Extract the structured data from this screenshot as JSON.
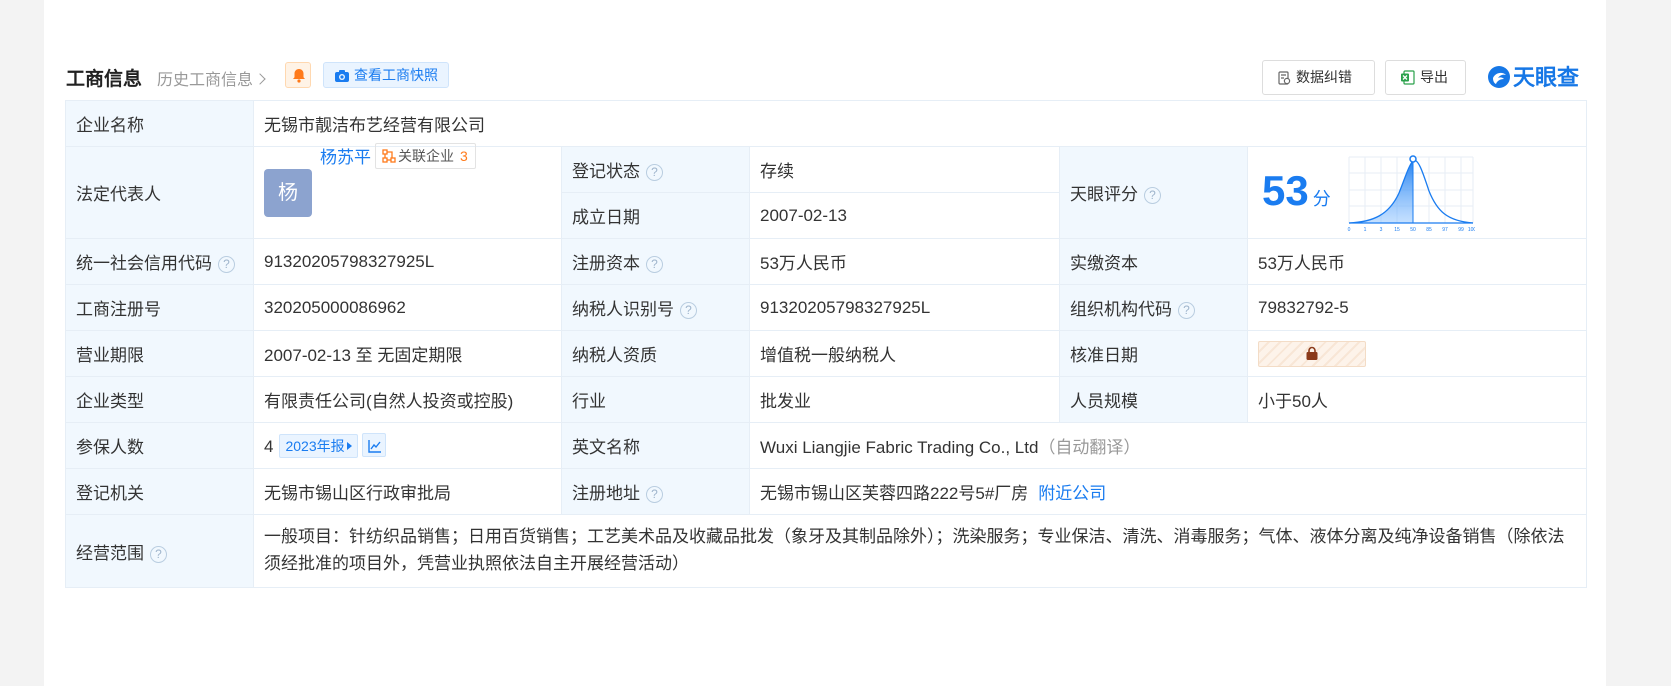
{
  "header": {
    "title": "工商信息",
    "history_link": "历史工商信息",
    "snapshot_button": "查看工商快照",
    "correct_button": "数据纠错",
    "export_button": "导出",
    "brand": "天眼查"
  },
  "labels": {
    "company_name": "企业名称",
    "legal_rep": "法定代表人",
    "reg_status": "登记状态",
    "establish_date": "成立日期",
    "tianyan_score": "天眼评分",
    "credit_code": "统一社会信用代码",
    "reg_capital": "注册资本",
    "paid_capital": "实缴资本",
    "reg_number": "工商注册号",
    "taxpayer_id": "纳税人识别号",
    "org_code": "组织机构代码",
    "business_term": "营业期限",
    "taxpayer_qual": "纳税人资质",
    "approval_date": "核准日期",
    "company_type": "企业类型",
    "industry": "行业",
    "staff_size": "人员规模",
    "insured_count": "参保人数",
    "english_name": "英文名称",
    "reg_authority": "登记机关",
    "reg_address": "注册地址",
    "business_scope": "经营范围"
  },
  "values": {
    "company_name": "无锡市靓洁布艺经营有限公司",
    "legal_rep_avatar": "杨",
    "legal_rep_name": "杨苏平",
    "related_label": "关联企业",
    "related_count": "3",
    "reg_status": "存续",
    "establish_date": "2007-02-13",
    "score": "53",
    "score_unit": "分",
    "credit_code": "91320205798327925L",
    "reg_capital": "53万人民币",
    "paid_capital": "53万人民币",
    "reg_number": "320205000086962",
    "taxpayer_id": "91320205798327925L",
    "org_code": "79832792-5",
    "business_term": "2007-02-13 至 无固定期限",
    "taxpayer_qual": "增值税一般纳税人",
    "company_type": "有限责任公司(自然人投资或控股)",
    "industry": "批发业",
    "staff_size": "小于50人",
    "insured_count": "4",
    "annual_report": "2023年报",
    "english_name": "Wuxi Liangjie Fabric Trading Co., Ltd",
    "auto_translate": "（自动翻译）",
    "reg_authority": "无锡市锡山区行政审批局",
    "reg_address": "无锡市锡山区芙蓉四路222号5#厂房",
    "nearby_link": "附近公司",
    "business_scope": "一般项目：针纺织品销售；日用百货销售；工艺美术品及收藏品批发（象牙及其制品除外）；洗染服务；专业保洁、清洗、消毒服务；气体、液体分离及纯净设备销售（除依法须经批准的项目外，凭营业执照依法自主开展经营活动）"
  },
  "score_chart": {
    "ticks": [
      "0",
      "1",
      "3",
      "15",
      "50",
      "85",
      "97",
      "99",
      "100"
    ],
    "marker_value": 50
  },
  "colors": {
    "accent": "#1a7cf0",
    "label_bg": "#f1f8fe",
    "status_green": "#2aa14b",
    "related_count": "#ff7a1a"
  }
}
